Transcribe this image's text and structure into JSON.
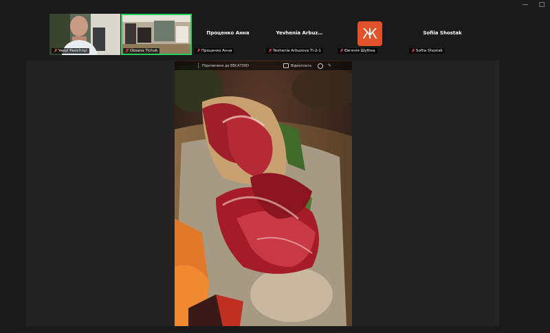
{
  "window": {
    "controls": [
      "—",
      "□"
    ]
  },
  "participants": [
    {
      "name": "Vasyl Pasichnyi",
      "type": "video",
      "muted": true
    },
    {
      "name": "Oksana Tichuk",
      "type": "video",
      "muted": true,
      "active": true
    },
    {
      "display_name": "Проценко Анна",
      "name": "Проценко Анна",
      "type": "name",
      "muted": true
    },
    {
      "display_name": "Yevhenia Arbuz…",
      "name": "Yevhenia Arbuzova TI-2-1",
      "type": "name",
      "muted": true
    },
    {
      "avatar_letter": "Ж",
      "name": "Євгенія Шубіна",
      "type": "avatar",
      "muted": true
    },
    {
      "display_name": "Sofiia Shostak",
      "name": "Sofiia Shostak",
      "type": "name",
      "muted": true
    }
  ],
  "share_bar": {
    "connected_text": "Підключено до EBCA730D",
    "view_options": "Відкоплата"
  },
  "colors": {
    "active_border": "#23d15f",
    "avatar_bg": "#e0532a",
    "mute": "#e23b3b"
  }
}
